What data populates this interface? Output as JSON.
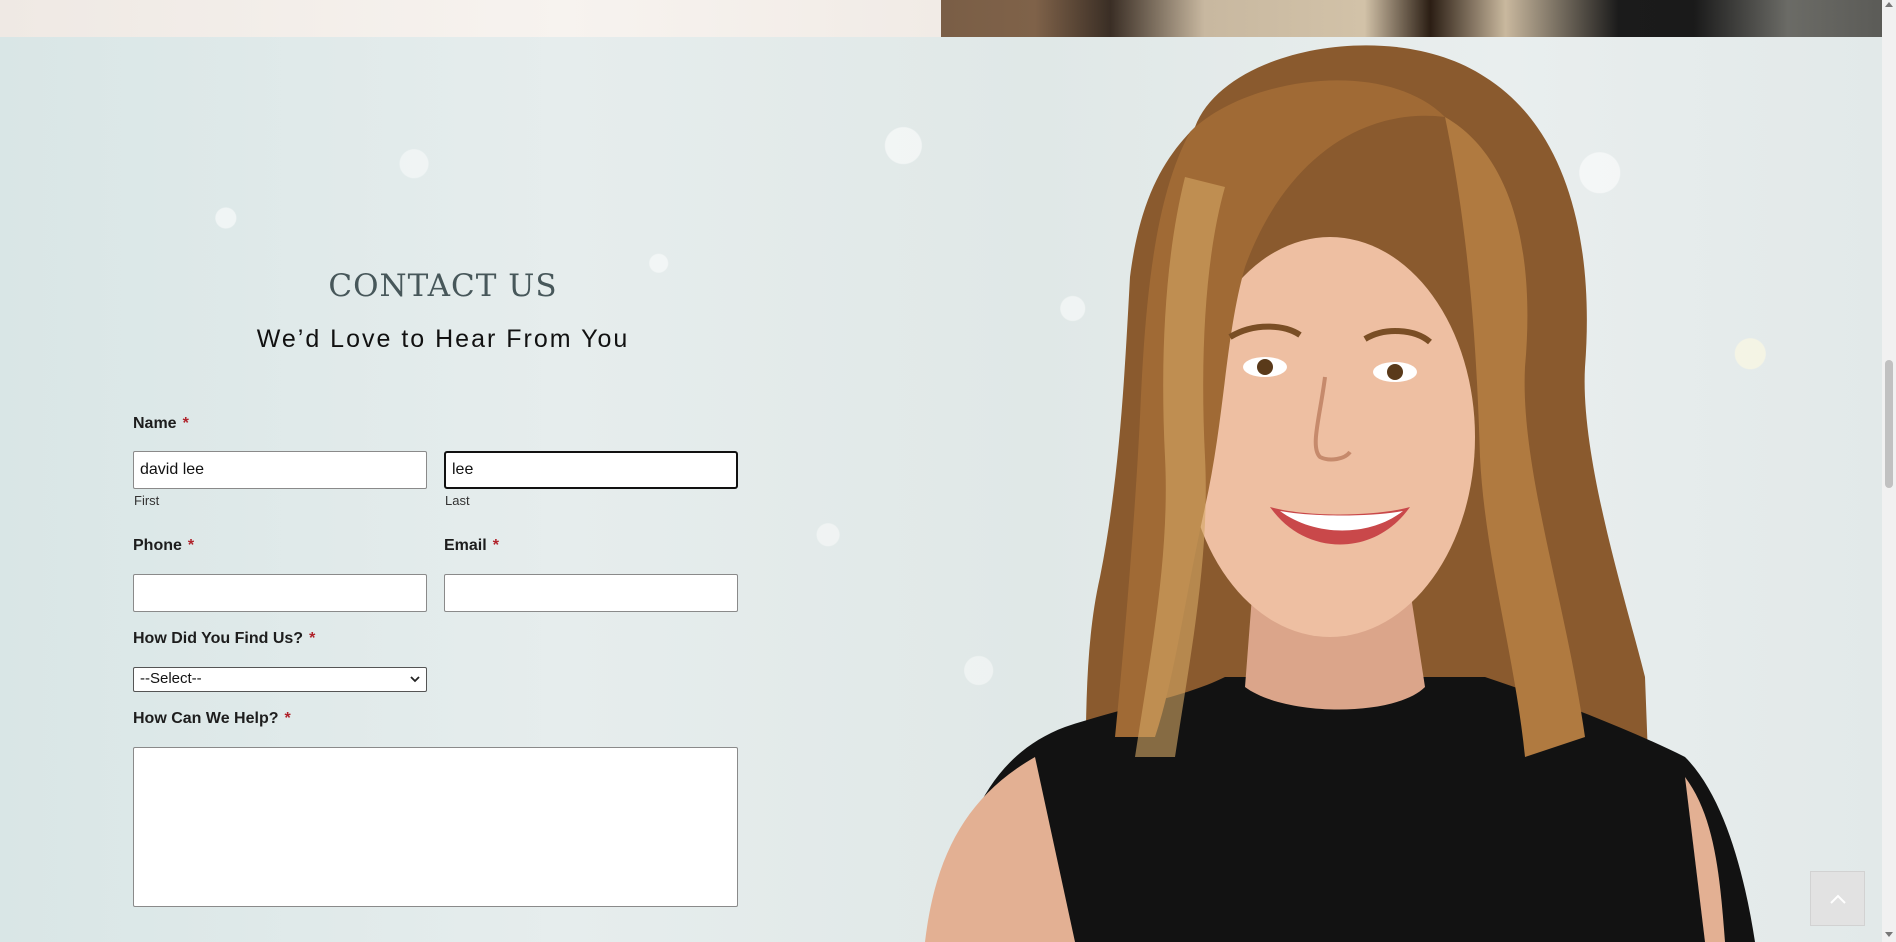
{
  "contact": {
    "title": "CONTACT US",
    "subtitle": "We’d Love to Hear From You"
  },
  "form": {
    "name_label": "Name",
    "required_marker": "*",
    "first_value": "david lee",
    "first_sublabel": "First",
    "last_value": "lee",
    "last_sublabel": "Last",
    "phone_label": "Phone",
    "phone_value": "",
    "email_label": "Email",
    "email_value": "",
    "find_label": "How Did You Find Us?",
    "find_selected": "--Select--",
    "help_label": "How Can We Help?",
    "help_value": ""
  },
  "icons": {
    "select_chevron": "chevron-down-icon",
    "back_to_top": "chevron-up-icon"
  },
  "colors": {
    "required": "#b0222a",
    "title": "#47575a"
  }
}
